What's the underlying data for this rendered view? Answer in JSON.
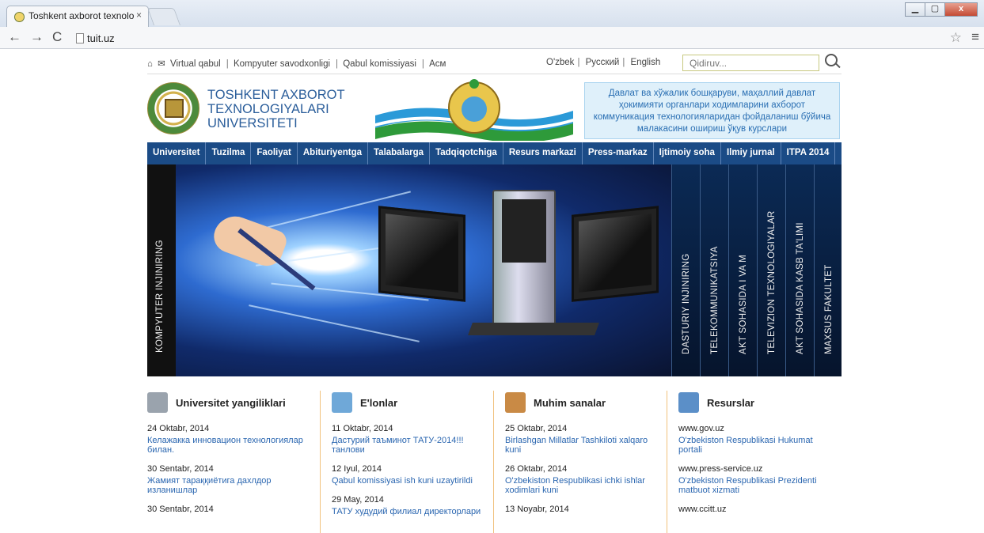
{
  "browser": {
    "tab_title": "Toshkent axborot texnolo",
    "tab_close": "×",
    "url": "tuit.uz",
    "win_min": "▁",
    "win_max": "▢",
    "win_close": "x"
  },
  "topbar": {
    "links": [
      "Virtual qabul",
      "Kompyuter savodxonligi",
      "Qabul komissiyasi",
      "Асм"
    ],
    "langs": [
      "O'zbek",
      "Русский",
      "English"
    ],
    "search_placeholder": "Qidiruv..."
  },
  "header": {
    "name_lines": [
      "TOSHKENT AXBOROT",
      "TEXNOLOGIYALARI",
      "UNIVERSITETI"
    ],
    "banner": "Давлат ва хўжалик бошқаруви, маҳаллий давлат ҳокимияти органлари ходимларини ахборот коммуникация технологияларидан фойдаланиш бўйича малакасини ошириш ўқув курслари"
  },
  "nav": [
    "Universitet",
    "Tuzilma",
    "Faoliyat",
    "Abituriyentga",
    "Talabalarga",
    "Tadqiqotchiga",
    "Resurs markazi",
    "Press-markaz",
    "Ijtimoiy soha",
    "Ilmiy jurnal",
    "ITPA 2014"
  ],
  "slider": {
    "left_label": "KOMPYUTER INJINIRING",
    "right_labels": [
      "DASTURIY INJINIRING",
      "TELEKOMMUNIKATSIYA",
      "AKT SOHASIDA I VA M",
      "TELEVIZION TEXNOLOGIYALAR",
      "AKT SOHASIDA KASB TA'LIMI",
      "MAXSUS FAKULTET"
    ]
  },
  "columns": [
    {
      "title": "Universitet yangiliklari",
      "icon": "news-icon",
      "entries": [
        {
          "date": "24 Oktabr, 2014",
          "text": "Келажакка инновацион технологиялар билан."
        },
        {
          "date": "30 Sentabr, 2014",
          "text": "Жамият тараққиётига дахлдор изланишлар"
        },
        {
          "date": "30 Sentabr, 2014",
          "text": ""
        }
      ]
    },
    {
      "title": "E'lonlar",
      "icon": "megaphone-icon",
      "entries": [
        {
          "date": "11 Oktabr, 2014",
          "text": "Дастурий таъминот ТАТУ-2014!!! танлови"
        },
        {
          "date": "12 Iyul, 2014",
          "text": "Qabul komissiyasi ish kuni uzaytirildi"
        },
        {
          "date": "29 May, 2014",
          "text": "ТАТУ худудий филиал директорлари"
        }
      ]
    },
    {
      "title": "Muhim sanalar",
      "icon": "calendar-icon",
      "entries": [
        {
          "date": "25 Oktabr, 2014",
          "text": "Birlashgan Millatlar Tashkiloti xalqaro kuni"
        },
        {
          "date": "26 Oktabr, 2014",
          "text": "O'zbekiston Respublikasi ichki ishlar xodimlari kuni"
        },
        {
          "date": "13 Noyabr, 2014",
          "text": ""
        }
      ]
    },
    {
      "title": "Resurslar",
      "icon": "resources-icon",
      "entries": [
        {
          "date": "www.gov.uz",
          "text": "O'zbekiston Respublikasi Hukumat portali"
        },
        {
          "date": "www.press-service.uz",
          "text": "O'zbekiston Respublikasi Prezidenti matbuot xizmati"
        },
        {
          "date": "www.ccitt.uz",
          "text": ""
        }
      ]
    }
  ],
  "colors": {
    "nav_bg": "#1b4b86",
    "link": "#2a66b0",
    "title": "#2a5d9a"
  }
}
